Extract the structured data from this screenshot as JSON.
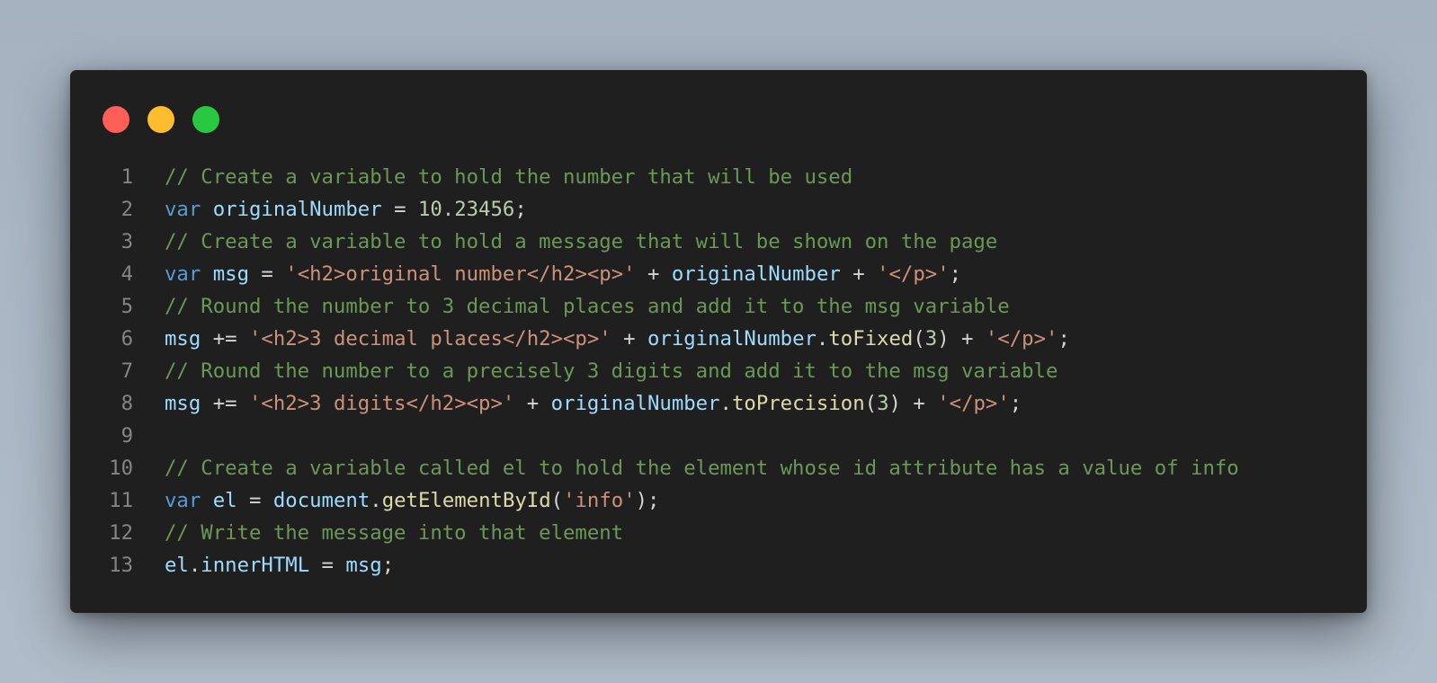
{
  "window": {
    "controls": [
      {
        "name": "close",
        "color": "#ff5f57"
      },
      {
        "name": "minimize",
        "color": "#febc2e"
      },
      {
        "name": "zoom",
        "color": "#28c840"
      }
    ]
  },
  "editor": {
    "language": "javascript",
    "lines": [
      {
        "number": "1",
        "tokens": [
          {
            "t": "comment",
            "v": "// Create a variable to hold the number that will be used"
          }
        ]
      },
      {
        "number": "2",
        "tokens": [
          {
            "t": "kw",
            "v": "var"
          },
          {
            "t": "op",
            "v": " "
          },
          {
            "t": "var",
            "v": "originalNumber"
          },
          {
            "t": "op",
            "v": " = "
          },
          {
            "t": "num",
            "v": "10.23456"
          },
          {
            "t": "op",
            "v": ";"
          }
        ]
      },
      {
        "number": "3",
        "tokens": [
          {
            "t": "comment",
            "v": "// Create a variable to hold a message that will be shown on the page"
          }
        ]
      },
      {
        "number": "4",
        "tokens": [
          {
            "t": "kw",
            "v": "var"
          },
          {
            "t": "op",
            "v": " "
          },
          {
            "t": "var",
            "v": "msg"
          },
          {
            "t": "op",
            "v": " = "
          },
          {
            "t": "str",
            "v": "'<h2>original number</h2><p>'"
          },
          {
            "t": "op",
            "v": " + "
          },
          {
            "t": "var",
            "v": "originalNumber"
          },
          {
            "t": "op",
            "v": " + "
          },
          {
            "t": "str",
            "v": "'</p>'"
          },
          {
            "t": "op",
            "v": ";"
          }
        ]
      },
      {
        "number": "5",
        "tokens": [
          {
            "t": "comment",
            "v": "// Round the number to 3 decimal places and add it to the msg variable"
          }
        ]
      },
      {
        "number": "6",
        "tokens": [
          {
            "t": "var",
            "v": "msg"
          },
          {
            "t": "op",
            "v": " += "
          },
          {
            "t": "str",
            "v": "'<h2>3 decimal places</h2><p>'"
          },
          {
            "t": "op",
            "v": " + "
          },
          {
            "t": "var",
            "v": "originalNumber"
          },
          {
            "t": "op",
            "v": "."
          },
          {
            "t": "fn",
            "v": "toFixed"
          },
          {
            "t": "op",
            "v": "("
          },
          {
            "t": "num",
            "v": "3"
          },
          {
            "t": "op",
            "v": ") + "
          },
          {
            "t": "str",
            "v": "'</p>'"
          },
          {
            "t": "op",
            "v": ";"
          }
        ]
      },
      {
        "number": "7",
        "tokens": [
          {
            "t": "comment",
            "v": "// Round the number to a precisely 3 digits and add it to the msg variable"
          }
        ]
      },
      {
        "number": "8",
        "tokens": [
          {
            "t": "var",
            "v": "msg"
          },
          {
            "t": "op",
            "v": " += "
          },
          {
            "t": "str",
            "v": "'<h2>3 digits</h2><p>'"
          },
          {
            "t": "op",
            "v": " + "
          },
          {
            "t": "var",
            "v": "originalNumber"
          },
          {
            "t": "op",
            "v": "."
          },
          {
            "t": "fn",
            "v": "toPrecision"
          },
          {
            "t": "op",
            "v": "("
          },
          {
            "t": "num",
            "v": "3"
          },
          {
            "t": "op",
            "v": ") + "
          },
          {
            "t": "str",
            "v": "'</p>'"
          },
          {
            "t": "op",
            "v": ";"
          }
        ]
      },
      {
        "number": "9",
        "tokens": []
      },
      {
        "number": "10",
        "tokens": [
          {
            "t": "comment",
            "v": "// Create a variable called el to hold the element whose id attribute has a value of info"
          }
        ]
      },
      {
        "number": "11",
        "tokens": [
          {
            "t": "kw",
            "v": "var"
          },
          {
            "t": "op",
            "v": " "
          },
          {
            "t": "var",
            "v": "el"
          },
          {
            "t": "op",
            "v": " = "
          },
          {
            "t": "var",
            "v": "document"
          },
          {
            "t": "op",
            "v": "."
          },
          {
            "t": "fn",
            "v": "getElementById"
          },
          {
            "t": "op",
            "v": "("
          },
          {
            "t": "str",
            "v": "'info'"
          },
          {
            "t": "op",
            "v": ");"
          }
        ]
      },
      {
        "number": "12",
        "tokens": [
          {
            "t": "comment",
            "v": "// Write the message into that element"
          }
        ]
      },
      {
        "number": "13",
        "tokens": [
          {
            "t": "var",
            "v": "el"
          },
          {
            "t": "op",
            "v": "."
          },
          {
            "t": "var",
            "v": "innerHTML"
          },
          {
            "t": "op",
            "v": " = "
          },
          {
            "t": "var",
            "v": "msg"
          },
          {
            "t": "op",
            "v": ";"
          }
        ]
      }
    ]
  }
}
